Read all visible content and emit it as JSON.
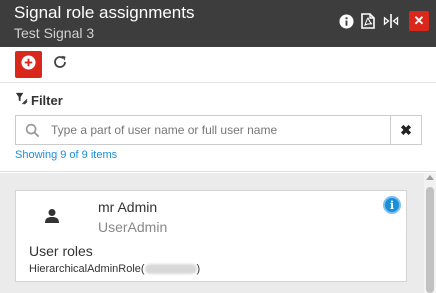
{
  "header": {
    "title": "Signal role assignments",
    "subtitle": "Test Signal 3",
    "icons": [
      "info-icon",
      "pdf-icon",
      "resize-icon",
      "close-icon"
    ],
    "close_label": "✕",
    "background": "#3d3d3d",
    "close_color": "#d9271c"
  },
  "toolbar": {
    "add_icon": "add-circle-icon",
    "refresh_icon": "refresh-icon"
  },
  "filter": {
    "label": "Filter",
    "placeholder": "Type a part of user name or full user name",
    "value": "",
    "clear_label": "✖",
    "showing": "Showing 9 of 9 items",
    "link_color": "#1a8fd8"
  },
  "list": {
    "items": [
      {
        "name": "mr Admin",
        "login": "UserAdmin",
        "roles_title": "User roles",
        "role_prefix": "HierarchicalAdminRole(",
        "role_suffix": ")",
        "info_label": "i"
      }
    ]
  }
}
